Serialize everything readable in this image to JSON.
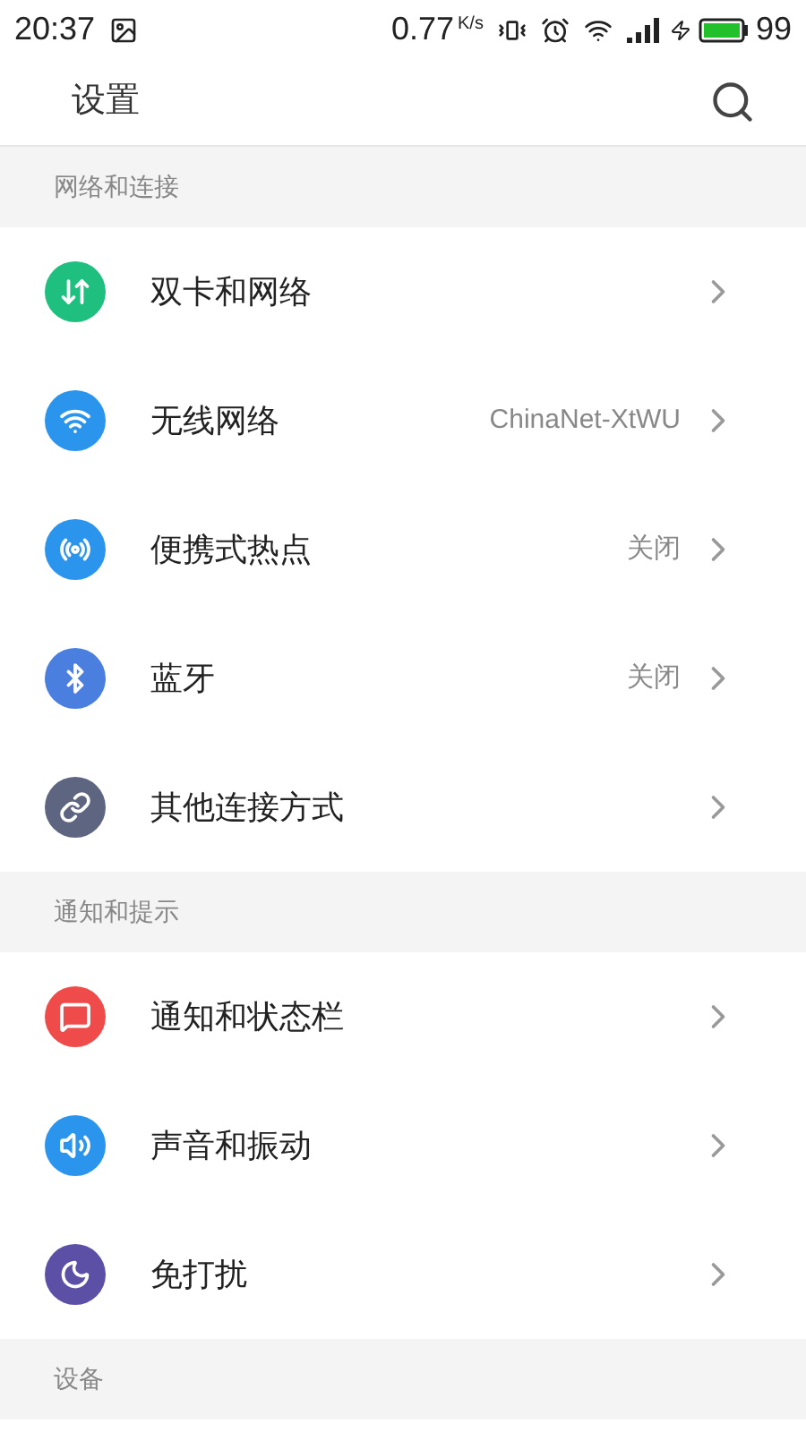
{
  "status_bar": {
    "time": "20:37",
    "speed": "0.77",
    "speed_unit": "K/s",
    "battery": "99"
  },
  "header": {
    "title": "设置"
  },
  "sections": [
    {
      "title": "网络和连接",
      "items": [
        {
          "label": "双卡和网络",
          "color": "#1fbf7f"
        },
        {
          "label": "无线网络",
          "value": "ChinaNet-XtWU",
          "color": "#2b95ee"
        },
        {
          "label": "便携式热点",
          "value": "关闭",
          "color": "#2b95ee"
        },
        {
          "label": "蓝牙",
          "value": "关闭",
          "color": "#4a7fe0"
        },
        {
          "label": "其他连接方式",
          "color": "#5d6580"
        }
      ]
    },
    {
      "title": "通知和提示",
      "items": [
        {
          "label": "通知和状态栏",
          "color": "#ef4b4b"
        },
        {
          "label": "声音和振动",
          "color": "#2b95ee"
        },
        {
          "label": "免打扰",
          "color": "#5b4fa6"
        }
      ]
    },
    {
      "title": "设备"
    }
  ]
}
